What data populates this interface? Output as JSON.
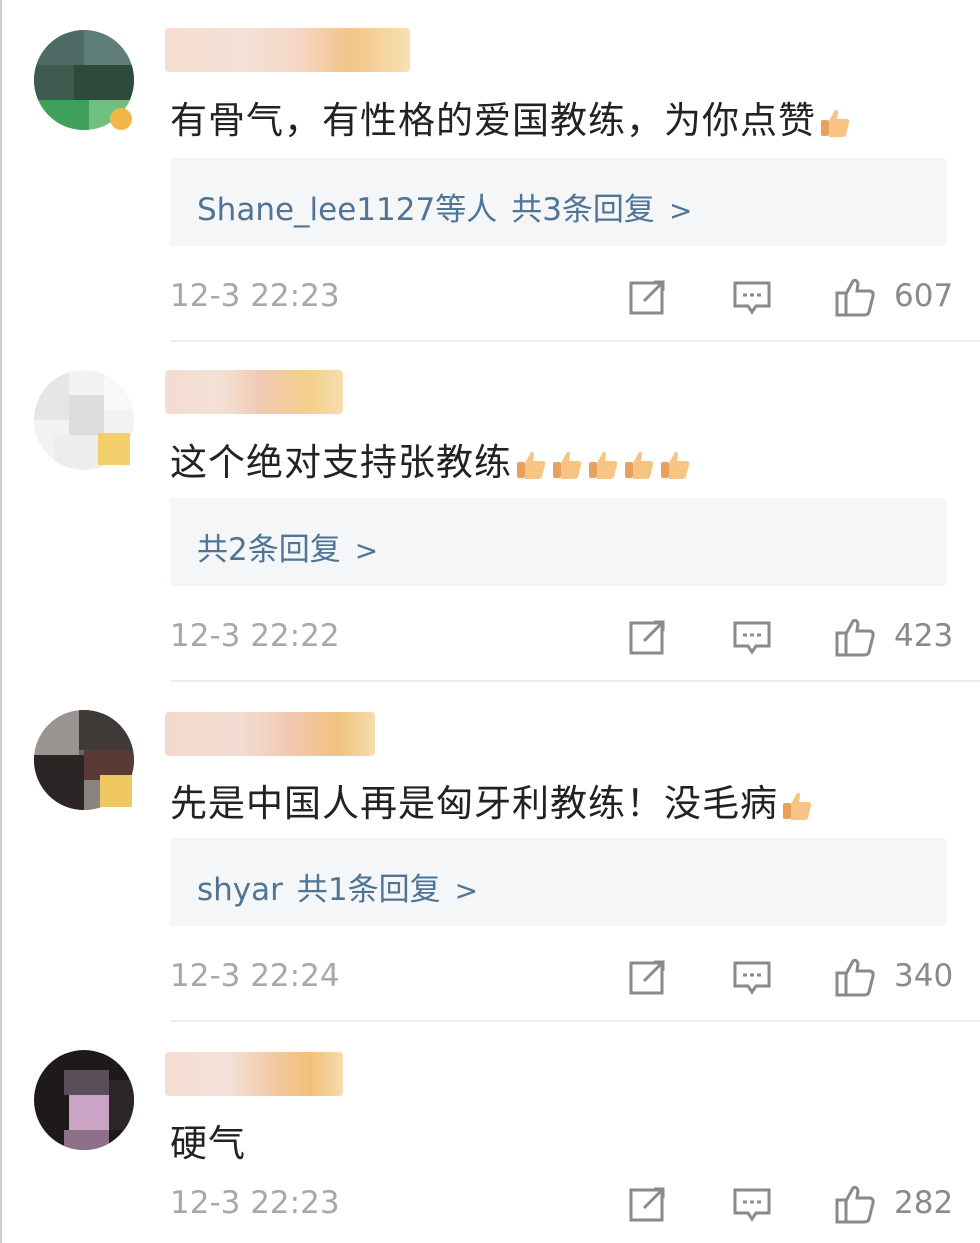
{
  "comments": [
    {
      "text": "有骨气，有性格的爱国教练，为你点赞",
      "thumbs": 1,
      "reply_users": "Shane_lee1127等人",
      "reply_count": "共3条回复",
      "time": "12-3 22:23",
      "likes": "607"
    },
    {
      "text": "这个绝对支持张教练",
      "thumbs": 5,
      "reply_users": "",
      "reply_count": "共2条回复",
      "time": "12-3 22:22",
      "likes": "423"
    },
    {
      "text": "先是中国人再是匈牙利教练！没毛病",
      "thumbs": 1,
      "reply_users": "shyar",
      "reply_count": "共1条回复",
      "time": "12-3 22:24",
      "likes": "340"
    },
    {
      "text": "硬气",
      "thumbs": 0,
      "time": "12-3 22:23",
      "likes": "282"
    }
  ],
  "icons": {
    "share": "share-icon",
    "comment": "comment-icon",
    "like": "thumbs-up-icon",
    "chevron": "chevron-right-icon"
  },
  "colors": {
    "reply_link": "#4f7496",
    "timestamp": "#a8a8a8",
    "reply_background": "#f5f6f7",
    "divider": "#ececec"
  }
}
